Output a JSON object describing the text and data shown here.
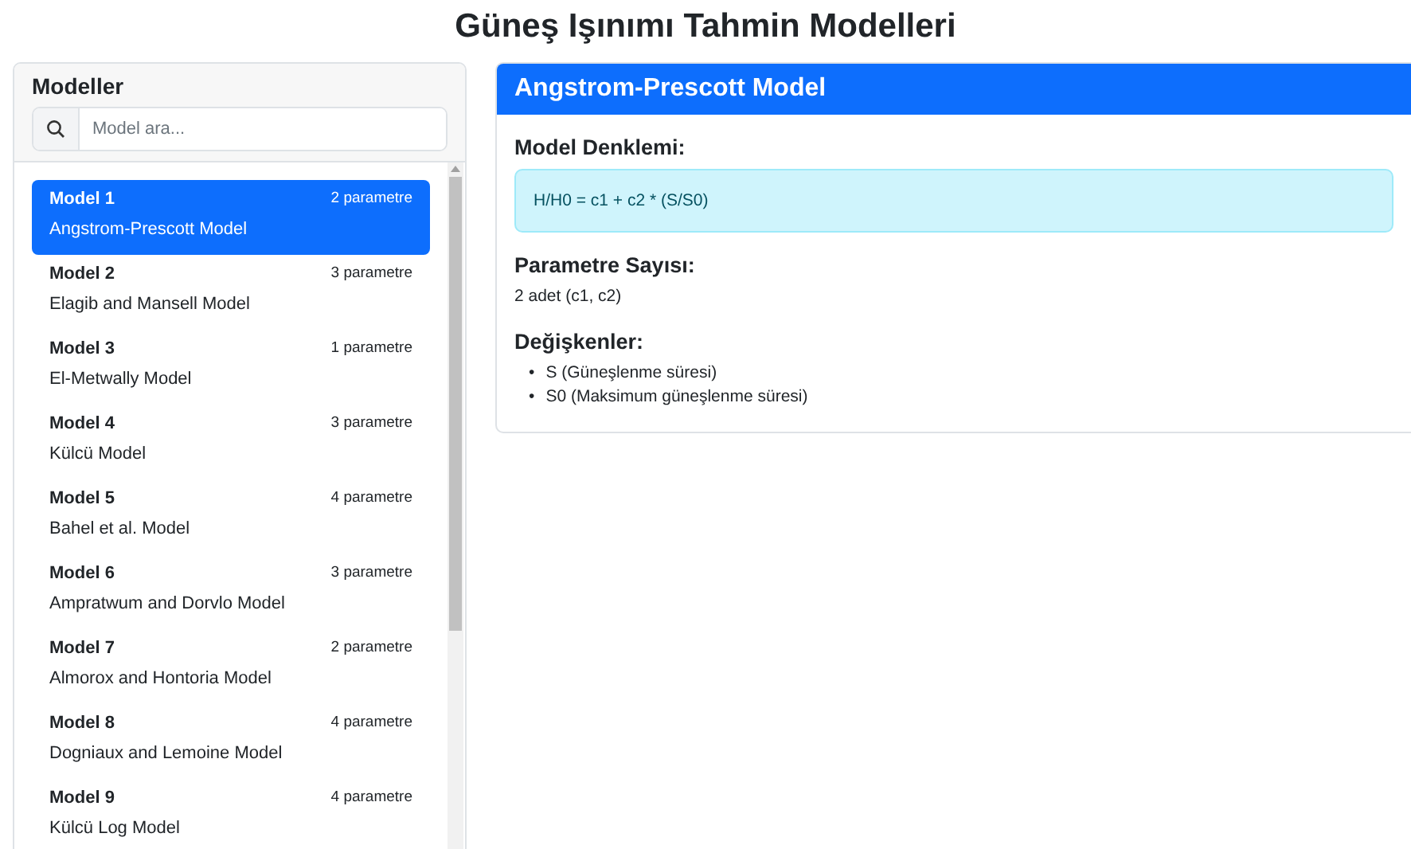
{
  "page_title": "Güneş Işınımı Tahmin Modelleri",
  "sidebar": {
    "title": "Modeller",
    "search": {
      "placeholder": "Model ara..."
    },
    "items": [
      {
        "label": "Model 1",
        "name": "Angstrom-Prescott Model",
        "params": "2 parametre",
        "selected": true
      },
      {
        "label": "Model 2",
        "name": "Elagib and Mansell Model",
        "params": "3 parametre",
        "selected": false
      },
      {
        "label": "Model 3",
        "name": "El-Metwally Model",
        "params": "1 parametre",
        "selected": false
      },
      {
        "label": "Model 4",
        "name": "Külcü Model",
        "params": "3 parametre",
        "selected": false
      },
      {
        "label": "Model 5",
        "name": "Bahel et al. Model",
        "params": "4 parametre",
        "selected": false
      },
      {
        "label": "Model 6",
        "name": "Ampratwum and Dorvlo Model",
        "params": "3 parametre",
        "selected": false
      },
      {
        "label": "Model 7",
        "name": "Almorox and Hontoria Model",
        "params": "2 parametre",
        "selected": false
      },
      {
        "label": "Model 8",
        "name": "Dogniaux and Lemoine Model",
        "params": "4 parametre",
        "selected": false
      },
      {
        "label": "Model 9",
        "name": "Külcü Log Model",
        "params": "4 parametre",
        "selected": false
      }
    ]
  },
  "detail": {
    "title": "Angstrom-Prescott Model",
    "sections": [
      {
        "kind": "equation",
        "heading": "Model Denklemi:",
        "text": "H/H0 = c1 + c2 * (S/S0)"
      },
      {
        "kind": "text",
        "heading": "Parametre Sayısı:",
        "text": "2 adet (c1, c2)"
      },
      {
        "kind": "list",
        "heading": "Değişkenler:",
        "items": [
          {
            "bullet": "•",
            "text": "S (Güneşlenme süresi)"
          },
          {
            "bullet": "•",
            "text": "S0 (Maksimum güneşlenme süresi)"
          }
        ]
      }
    ]
  }
}
